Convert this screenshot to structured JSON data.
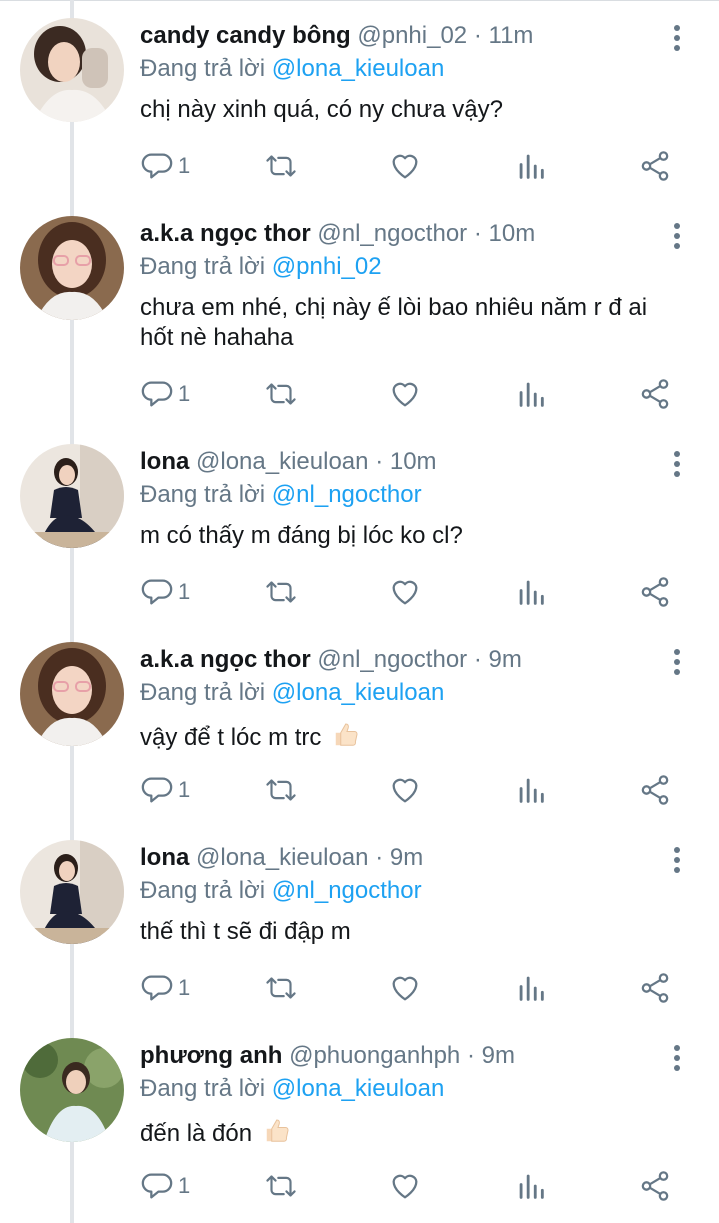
{
  "replying_prefix": "Đang trả lời",
  "colors": {
    "link": "#1da1f2",
    "muted": "#657786",
    "text": "#14171a",
    "thread": "#e1e4e8"
  },
  "tweets": [
    {
      "name": "candy candy bông",
      "handle": "@pnhi_02",
      "time": "11m",
      "reply_to": "@lona_kieuloan",
      "text": "chị này xinh quá, có ny chưa vậy?",
      "reply_count": "1"
    },
    {
      "name": "a.k.a ngọc thor",
      "handle": "@nl_ngocthor",
      "time": "10m",
      "reply_to": "@pnhi_02",
      "text": "chưa em nhé, chị này ế lòi bao nhiêu năm r đ ai hốt nè hahaha",
      "reply_count": "1"
    },
    {
      "name": "lona",
      "handle": "@lona_kieuloan",
      "time": "10m",
      "reply_to": "@nl_ngocthor",
      "text": "m có thấy m đáng bị lóc ko cl?",
      "reply_count": "1"
    },
    {
      "name": "a.k.a ngọc thor",
      "handle": "@nl_ngocthor",
      "time": "9m",
      "reply_to": "@lona_kieuloan",
      "text": "vậy để t lóc m trc",
      "emoji": "thumbs-up",
      "reply_count": "1"
    },
    {
      "name": "lona",
      "handle": "@lona_kieuloan",
      "time": "9m",
      "reply_to": "@nl_ngocthor",
      "text": "thế thì t sẽ đi đập m",
      "reply_count": "1"
    },
    {
      "name": "phương anh",
      "handle": "@phuonganhph",
      "time": "9m",
      "reply_to": "@lona_kieuloan",
      "text": "đến là đón",
      "emoji": "thumbs-up",
      "reply_count": "1"
    }
  ]
}
